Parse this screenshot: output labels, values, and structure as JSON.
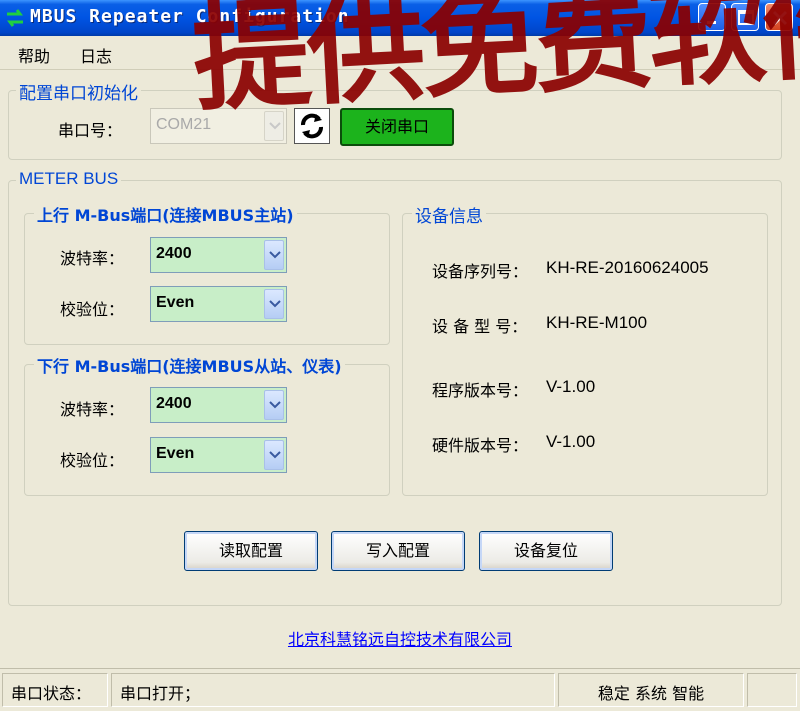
{
  "window": {
    "title": "MBUS Repeater Configuration"
  },
  "menu": [
    "帮助",
    "日志"
  ],
  "serial_init": {
    "title": "配置串口初始化",
    "port_label": "串口号：",
    "port_value": "COM21",
    "close_port_label": "关闭串口"
  },
  "meter_bus": {
    "title": "METER BUS",
    "upstream": {
      "title": "上行 M-Bus端口(连接MBUS主站)",
      "baud_label": "波特率：",
      "baud_value": "2400",
      "parity_label": "校验位：",
      "parity_value": "Even"
    },
    "downstream": {
      "title": "下行 M-Bus端口(连接MBUS从站、仪表)",
      "baud_label": "波特率：",
      "baud_value": "2400",
      "parity_label": "校验位：",
      "parity_value": "Even"
    },
    "device_info": {
      "title": "设备信息",
      "serial_label": "设备序列号：",
      "serial_value": "KH-RE-20160624005",
      "model_label": "设 备 型 号：",
      "model_value": "KH-RE-M100",
      "fw_label": "程序版本号：",
      "fw_value": "V-1.00",
      "hw_label": "硬件版本号：",
      "hw_value": "V-1.00"
    }
  },
  "actions": {
    "read": "读取配置",
    "write": "写入配置",
    "reset": "设备复位"
  },
  "company_link": "北京科慧铭远自控技术有限公司",
  "status": {
    "label": "串口状态：",
    "state": "串口打开；",
    "slogan": "稳定 系统 智能"
  },
  "overlay": {
    "text": "提供免费软件!"
  },
  "colors": {
    "title_bar": "#0054e3",
    "group_title": "#0046d5",
    "combo_bg": "#c8eec8",
    "close_port_btn": "#1cb31c",
    "watermark": "#8b0000"
  }
}
